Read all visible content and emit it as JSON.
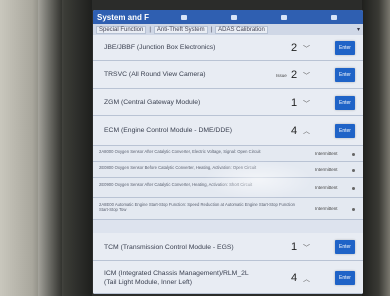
{
  "window": {
    "title": "System and F"
  },
  "tabs": [
    {
      "label": "Special Function"
    },
    {
      "label": "Anti-Theft System"
    },
    {
      "label": "ADAS Calibration"
    }
  ],
  "modules": [
    {
      "name": "JBE/JBBF (Junction Box Electronics)",
      "count": "2",
      "enter": "Enter"
    },
    {
      "name": "TRSVC (All Round View Camera)",
      "note": "Issue",
      "count": "2",
      "enter": "Enter"
    },
    {
      "name": "ZGM (Central Gateway Module)",
      "count": "1",
      "enter": "Enter"
    },
    {
      "name": "ECM (Engine Control Module - DME/DDE)",
      "count": "4",
      "enter": "Enter"
    }
  ],
  "faults": [
    {
      "text": "2A8000 Oxygen Sensor After Catalytic Converter, Electric Voltage, Signal: Open Circuit",
      "status": "Intermittent"
    },
    {
      "text": "2E0800 Oxygen Sensor Before Catalytic Converter, Heating, Activation: Open Circuit",
      "status": "Intermittent"
    },
    {
      "text": "2E0900 Oxygen Sensor After Catalytic Converter, Heating, Activation: Short Circuit",
      "status": "Intermittent"
    },
    {
      "text": "2A8E00 Automatic Engine Start-Stop Function: Speed Reduction at Automatic Engine Start-Stop Function Start-Stop Tow",
      "status": "Intermittent"
    }
  ],
  "modules2": [
    {
      "name": "TCM (Transmission Control Module - EGS)",
      "count": "1",
      "enter": "Enter"
    },
    {
      "name": "ICM (Integrated Chassis Management)/RLM_2L (Tail Light Module, Inner Left)",
      "name_line1": "ICM (Integrated Chassis Management)/RLM_2L",
      "name_line2": "(Tail Light Module, Inner Left)",
      "count": "4",
      "enter": "Enter"
    }
  ],
  "icons": [
    "chevron-down-icon",
    "chevron-up-icon",
    "dropdown-icon"
  ],
  "colors": {
    "titlebar": "#2f5fb1",
    "enter_button": "#1f63c7",
    "row_bg": "#e8ecf3"
  }
}
